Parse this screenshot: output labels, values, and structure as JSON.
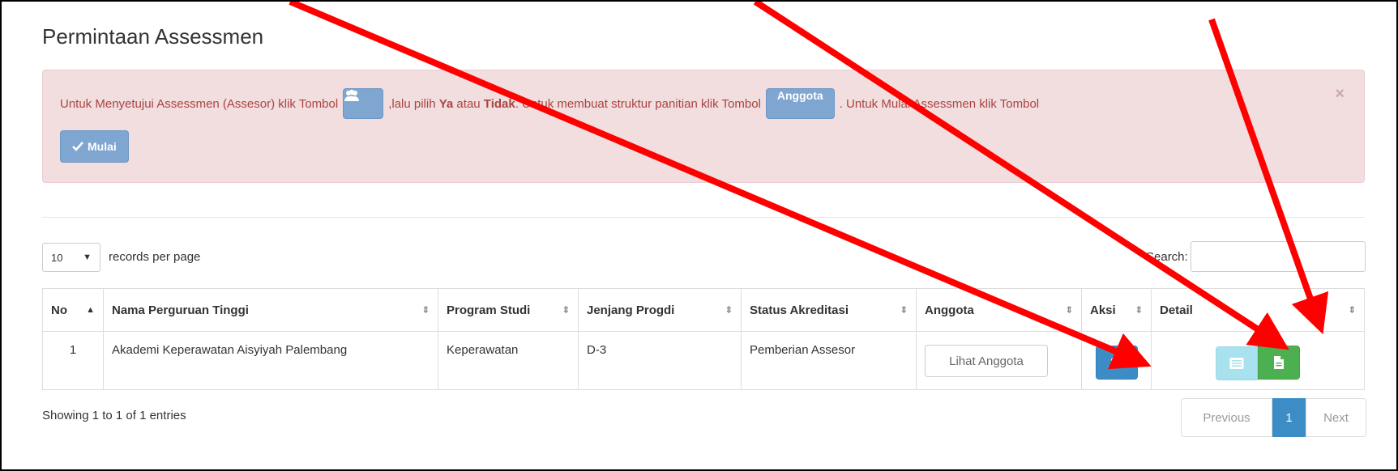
{
  "title": "Permintaan Assessmen",
  "alert": {
    "text1": "Untuk Menyetujui Assessmen (Assesor) klik Tombol",
    "text2": ",lalu pilih ",
    "bold_ya": "Ya",
    "text3": " atau ",
    "bold_tidak": "Tidak",
    "text4": ". Untuk membuat struktur panitian klik Tombol",
    "anggota_label": "Anggota",
    "text5": ". Untuk Mulai Assessmen klik Tombol",
    "mulai_label": "Mulai",
    "close": "×"
  },
  "length": {
    "value": "10",
    "label": "records per page"
  },
  "search": {
    "label": "Search:",
    "placeholder": ""
  },
  "table": {
    "headers": [
      "No",
      "Nama Perguruan Tinggi",
      "Program Studi",
      "Jenjang Progdi",
      "Status Akreditasi",
      "Anggota",
      "Aksi",
      "Detail"
    ],
    "rows": [
      {
        "no": "1",
        "nama": "Akademi Keperawatan Aisyiyah Palembang",
        "prodi": "Keperawatan",
        "jenjang": "D-3",
        "status": "Pemberian Assesor",
        "anggota_btn": "Lihat Anggota"
      }
    ]
  },
  "info": "Showing 1 to 1 of 1 entries",
  "pager": {
    "prev": "Previous",
    "page": "1",
    "next": "Next"
  },
  "colors": {
    "alert_bg": "#f2dede",
    "alert_text": "#a94442",
    "primary": "#3c8dc5",
    "muted_btn": "#7fa5d1",
    "info_btn": "#a9e2ef",
    "success_btn": "#4cb050",
    "arrow": "#ff0000"
  },
  "icons": {
    "group": "users-icon",
    "check": "check-icon",
    "list": "list-icon",
    "doc": "file-icon"
  }
}
